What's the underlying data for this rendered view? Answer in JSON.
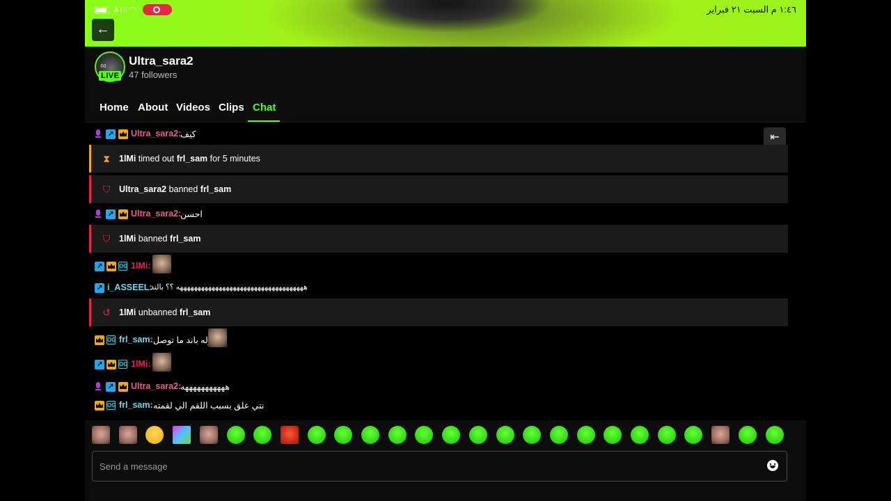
{
  "status_bar": {
    "time_date": "١:٤٦ م   السبت ٢١ فبراير",
    "battery": "٨١٪"
  },
  "channel": {
    "name": "Ultra_sara2",
    "followers": "47 followers",
    "live_label": "LIVE"
  },
  "tabs": [
    "Home",
    "About",
    "Videos",
    "Clips",
    "Chat"
  ],
  "active_tab": "Chat",
  "chat": {
    "messages": [
      {
        "type": "chat",
        "user": "Ultra_sara2:",
        "text": "كيف",
        "badges": [
          "mic",
          "arrow",
          "crown"
        ]
      },
      {
        "type": "system",
        "style": "timeout",
        "actor": "1lMi",
        "action": " timed out ",
        "target": "frl_sam",
        "suffix": " for 5 minutes"
      },
      {
        "type": "system",
        "style": "ban",
        "actor": "Ultra_sara2",
        "action": " banned ",
        "target": "frl_sam"
      },
      {
        "type": "chat",
        "user": "Ultra_sara2:",
        "text": "احسن",
        "badges": [
          "mic",
          "arrow",
          "crown"
        ]
      },
      {
        "type": "system",
        "style": "ban",
        "actor": "1lMi",
        "action": " banned ",
        "target": "frl_sam"
      },
      {
        "type": "chat",
        "user": "1lMi:",
        "text": "",
        "badges": [
          "arrow",
          "crown",
          "og"
        ],
        "emote": "photo"
      },
      {
        "type": "chat",
        "user": "i_ASSEEL:",
        "text": "ههههههههههههههههههههههههههههههههههههه ؟؟ بالند",
        "badges": [
          "arrow"
        ]
      },
      {
        "type": "system",
        "style": "unban",
        "actor": "1lMi",
        "action": " unbanned ",
        "target": "frl_sam"
      },
      {
        "type": "chat",
        "user": "frl_sam:",
        "text": "اوله باند ما توصل",
        "badges": [
          "crown",
          "og"
        ],
        "emote": "photo"
      },
      {
        "type": "chat",
        "user": "1lMi:",
        "text": "",
        "badges": [
          "arrow",
          "crown",
          "og"
        ],
        "emote": "photo"
      },
      {
        "type": "chat",
        "user": "Ultra_sara2:",
        "text": "هههههههههههه",
        "badges": [
          "mic",
          "arrow",
          "crown"
        ]
      },
      {
        "type": "chat",
        "user": "frl_sam:",
        "text": "نتي علق بسبب اللقم الي لقمته",
        "badges": [
          "crown",
          "og"
        ]
      }
    ]
  },
  "emote_bar": [
    "photo-emote",
    "photo-emote",
    "smile-emote",
    "pixel-emote",
    "photo-emote",
    "green-emote",
    "green-emote",
    "red-emote",
    "green-emote",
    "green-emote",
    "green-emote",
    "green-emote",
    "green-emote",
    "green-emote",
    "green-emote",
    "green-emote",
    "green-emote",
    "green-emote",
    "green-emote",
    "green-emote",
    "green-emote",
    "green-emote",
    "green-emote",
    "photo-emote",
    "green-emote",
    "green-emote"
  ],
  "input": {
    "placeholder": "Send a message"
  },
  "colors": {
    "accent": "#53fc18",
    "ban_red": "#e8264a",
    "timeout_orange": "#f2a81b"
  }
}
